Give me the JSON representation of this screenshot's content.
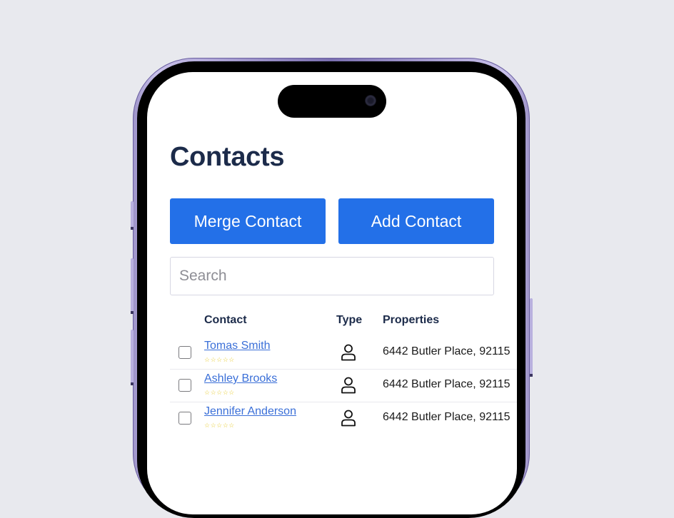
{
  "page": {
    "title": "Contacts"
  },
  "toolbar": {
    "merge_label": "Merge Contact",
    "add_label": "Add Contact"
  },
  "search": {
    "placeholder": "Search",
    "value": ""
  },
  "table": {
    "columns": [
      "Contact",
      "Type",
      "Properties"
    ],
    "rows": [
      {
        "name": "Tomas Smith",
        "rating_stars": "☆☆☆☆☆",
        "rating": 0,
        "type_icon": "person-icon",
        "property": "6442 Butler Place, 92115",
        "checked": false
      },
      {
        "name": "Ashley Brooks",
        "rating_stars": "☆☆☆☆☆",
        "rating": 0,
        "type_icon": "person-icon",
        "property": "6442 Butler Place, 92115",
        "checked": false
      },
      {
        "name": "Jennifer Anderson",
        "rating_stars": "☆☆☆☆☆",
        "rating": 0,
        "type_icon": "person-icon",
        "property": "6442 Butler Place, 92115",
        "checked": false
      }
    ]
  },
  "colors": {
    "primary_button": "#2370e8",
    "title": "#1c2b4a",
    "link": "#3a6fd8",
    "star": "#e9cf3a",
    "background": "#e8e9ee"
  }
}
